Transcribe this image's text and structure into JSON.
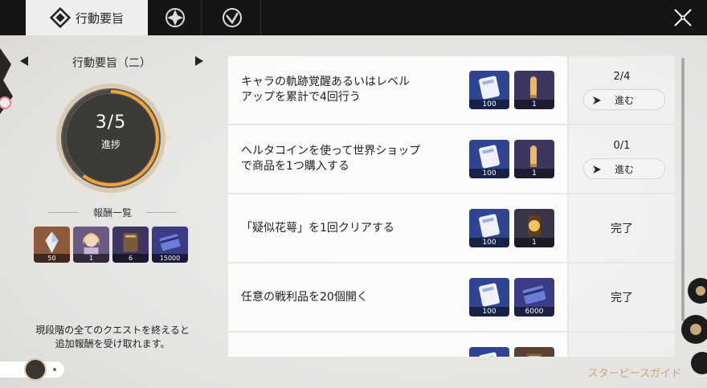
{
  "tabs": [
    {
      "label": "行動要旨",
      "icon": "diamond-emblem-icon",
      "active": true
    },
    {
      "label": "",
      "icon": "crest-icon",
      "active": false
    },
    {
      "label": "",
      "icon": "shield-check-icon",
      "active": false
    }
  ],
  "close_icon": "close-icon",
  "stage": {
    "title": "行動要旨（二）",
    "prev_icon": "triangle-left-icon",
    "next_icon": "triangle-right-icon"
  },
  "progress_dial": {
    "count": "3/5",
    "label": "進捗",
    "fraction": 0.6
  },
  "rewards": {
    "heading": "報酬一覧",
    "items": [
      {
        "icon": "crystal-icon",
        "qty": "50",
        "bg": "#8e5a3c"
      },
      {
        "icon": "character-portrait-icon",
        "qty": "1",
        "bg": "#6d5a80"
      },
      {
        "icon": "book-icon",
        "qty": "6",
        "bg": "#3e3560"
      },
      {
        "icon": "credit-card-icon",
        "qty": "15000",
        "bg": "#3a3c86"
      }
    ]
  },
  "notice": [
    "現段階の全てのクエストを終えると",
    "追加報酬を受け取れます。"
  ],
  "quests": [
    {
      "text": [
        "キャラの軌跡覚醒あるいはレベル",
        "アップを累計で4回行う"
      ],
      "items": [
        {
          "icon": "card-icon",
          "qty": "100",
          "bg": "#2f4592"
        },
        {
          "icon": "bullet-icon",
          "qty": "1",
          "bg": "#3e3560"
        }
      ],
      "progress": "2/4",
      "button": "進む",
      "status": ""
    },
    {
      "text": [
        "ヘルタコインを使って世界ショップ",
        "で商品を1つ購入する"
      ],
      "items": [
        {
          "icon": "card-icon",
          "qty": "100",
          "bg": "#2f4592"
        },
        {
          "icon": "bullet-icon",
          "qty": "1",
          "bg": "#3e3560"
        }
      ],
      "progress": "0/1",
      "button": "進む",
      "status": ""
    },
    {
      "text": [
        "「疑似花萼」を1回クリアする"
      ],
      "items": [
        {
          "icon": "card-icon",
          "qty": "100",
          "bg": "#2f4592"
        },
        {
          "icon": "lantern-icon",
          "qty": "1",
          "bg": "#3a3548"
        }
      ],
      "progress": "",
      "button": "",
      "status": "完了"
    },
    {
      "text": [
        "任意の戦利品を20個開く"
      ],
      "items": [
        {
          "icon": "card-icon",
          "qty": "100",
          "bg": "#2f4592"
        },
        {
          "icon": "credit-card-icon",
          "qty": "6000",
          "bg": "#3a3c86"
        }
      ],
      "progress": "",
      "button": "",
      "status": "完了"
    },
    {
      "text": [
        ""
      ],
      "items": [
        {
          "icon": "card-icon",
          "qty": "",
          "bg": "#2f4592"
        },
        {
          "icon": "book-icon",
          "qty": "",
          "bg": "#5a4030"
        }
      ],
      "progress": "",
      "button": "",
      "status": ""
    }
  ],
  "go_icon": "navigate-icon",
  "guide": "スターピースガイド"
}
